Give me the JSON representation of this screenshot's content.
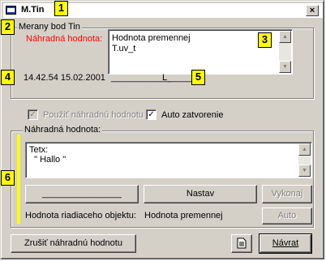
{
  "window": {
    "title": "M.Tin",
    "close_glyph": "×"
  },
  "callouts": [
    "1",
    "2",
    "3",
    "4",
    "5",
    "6"
  ],
  "meas_group": {
    "label": "Merany bod Tin",
    "substitute_label": "Náhradná hodnota:",
    "var_lines": [
      "Hodnota premennej",
      "T.uv_t"
    ],
    "timestamp": "14.42.54 15.02.2001",
    "value_blank": "____________",
    "flag": "L",
    "flag_blank": "_____"
  },
  "options": {
    "use_substitute_label": "Použiť náhradnú hodnotu",
    "use_substitute_checked": "✓",
    "auto_close_label": "Auto zatvorenie",
    "auto_close_checked": "✓"
  },
  "sub_group": {
    "label": "Náhradná hodnota:",
    "text_lines": [
      "Tetx:",
      "  \" Hallo \""
    ],
    "value_button_label": "________________",
    "set_button_label": "Nastav",
    "execute_button_label": "Vykonaj",
    "control_object_label": "Hodnota riadiaceho objektu:",
    "control_object_value": "Hodnota premennej",
    "auto_button_label": "Auto"
  },
  "footer": {
    "cancel_button_label": "Zrušiť náhradnú hodnotu",
    "back_button_label": "Návrat"
  },
  "icons": {
    "window_icon": "window-icon",
    "close": "close-icon",
    "scroll_up": "▲",
    "scroll_down": "▼",
    "notes": "document-icon"
  },
  "colors": {
    "callout": "#ffff00",
    "substitute_label": "#ff0000",
    "marker_bar": "#ffff00"
  }
}
